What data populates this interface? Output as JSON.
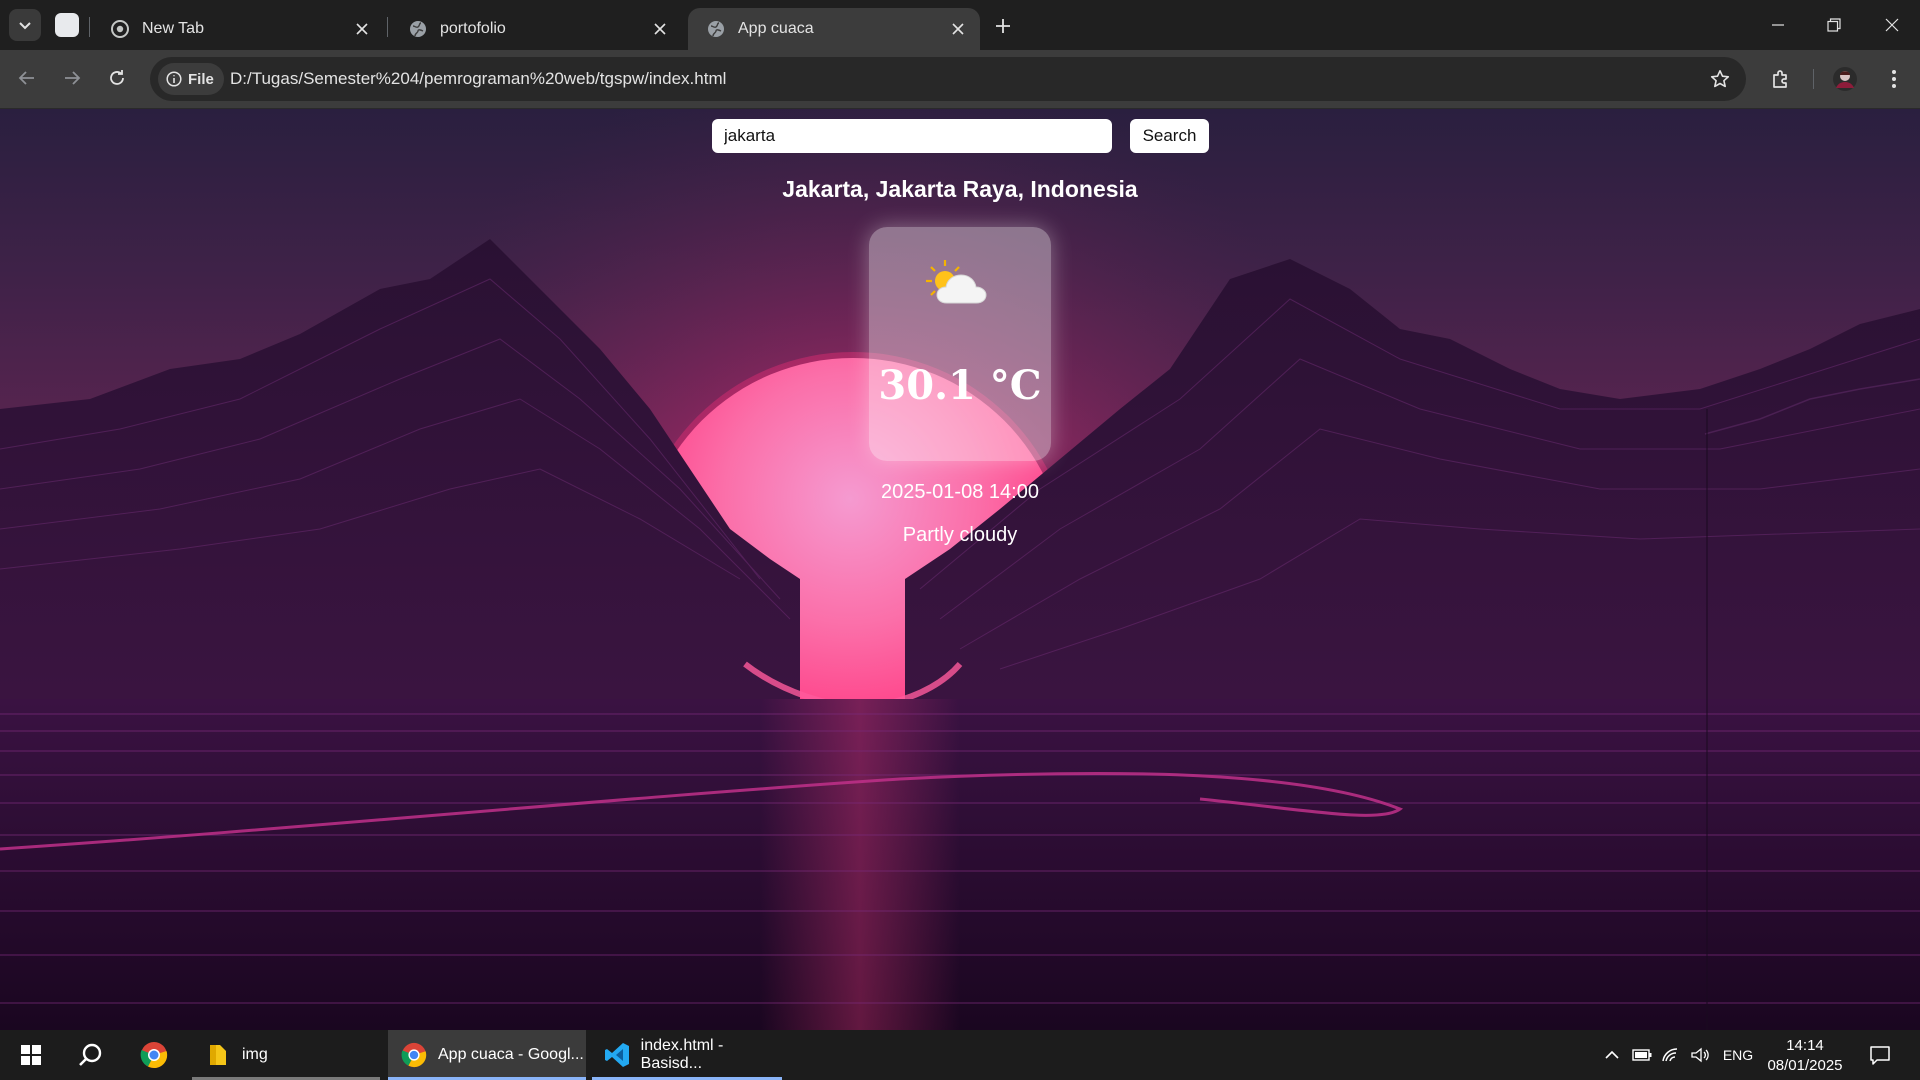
{
  "browser": {
    "tabs": [
      {
        "title": "New Tab",
        "icon": "chrome-icon",
        "active": false
      },
      {
        "title": "portofolio",
        "icon": "globe-icon",
        "active": false
      },
      {
        "title": "App cuaca",
        "icon": "globe-icon",
        "active": true
      }
    ],
    "address": {
      "chip_label": "File",
      "url": "D:/Tugas/Semester%204/pemrograman%20web/tgspw/index.html"
    }
  },
  "page": {
    "search": {
      "value": "jakarta",
      "button_label": "Search"
    },
    "location": "Jakarta, Jakarta Raya, Indonesia",
    "weather": {
      "icon": "partly-cloudy-icon",
      "temperature": "30.1 °C",
      "datetime": "2025-01-08 14:00",
      "condition": "Partly cloudy"
    }
  },
  "taskbar": {
    "apps": [
      {
        "label": "img",
        "icon": "folder-icon"
      },
      {
        "label": "App cuaca - Googl...",
        "icon": "chrome-icon",
        "active": true
      },
      {
        "label": "index.html - Basisd...",
        "icon": "vscode-icon"
      }
    ],
    "language": "ENG",
    "time": "14:14",
    "date": "08/01/2025"
  },
  "colors": {
    "tab_active": "#3c3c3c",
    "toolbar": "#3c3c3c",
    "sun": "#ff5aa0",
    "taskbar": "#1c1c1c"
  }
}
